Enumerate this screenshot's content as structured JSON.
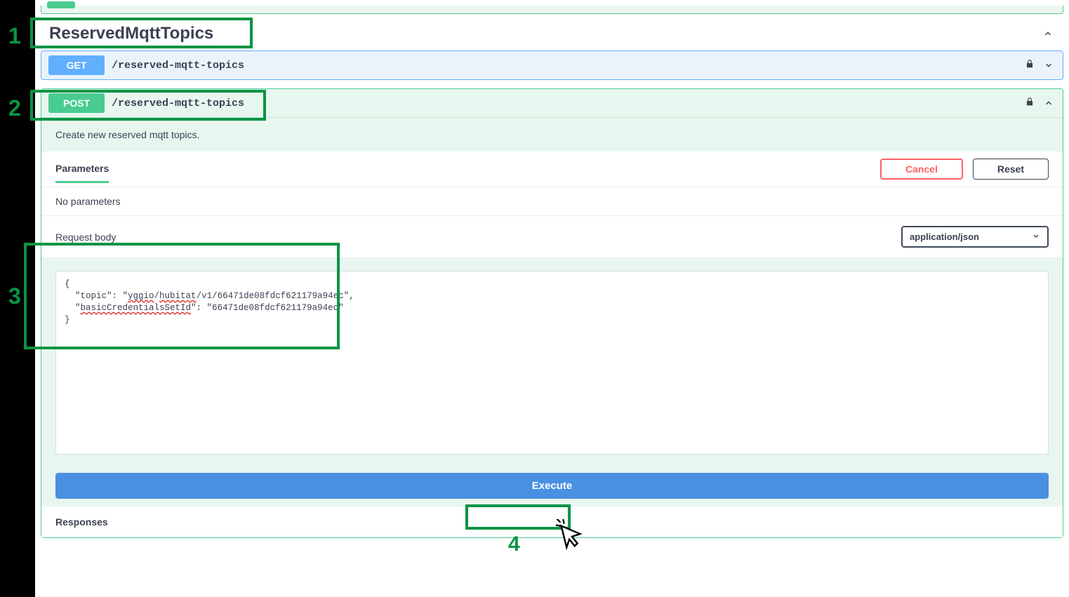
{
  "annotations": {
    "n1": "1",
    "n2": "2",
    "n3": "3",
    "n4": "4"
  },
  "section": {
    "title": "ReservedMqttTopics"
  },
  "ops": {
    "get": {
      "method": "GET",
      "path": "/reserved-mqtt-topics"
    },
    "post": {
      "method": "POST",
      "path": "/reserved-mqtt-topics",
      "description": "Create new reserved mqtt topics.",
      "parameters_label": "Parameters",
      "cancel": "Cancel",
      "reset": "Reset",
      "no_parameters": "No parameters",
      "request_body_label": "Request body",
      "content_type": "application/json",
      "body_text": "{\n  \"topic\": \"yggio/hubitat/v1/66471de08fdcf621179a94ec\",\n  \"basicCredentialsSetId\": \"66471de08fdcf621179a94ec\"\n}",
      "execute": "Execute",
      "responses_label": "Responses"
    }
  }
}
